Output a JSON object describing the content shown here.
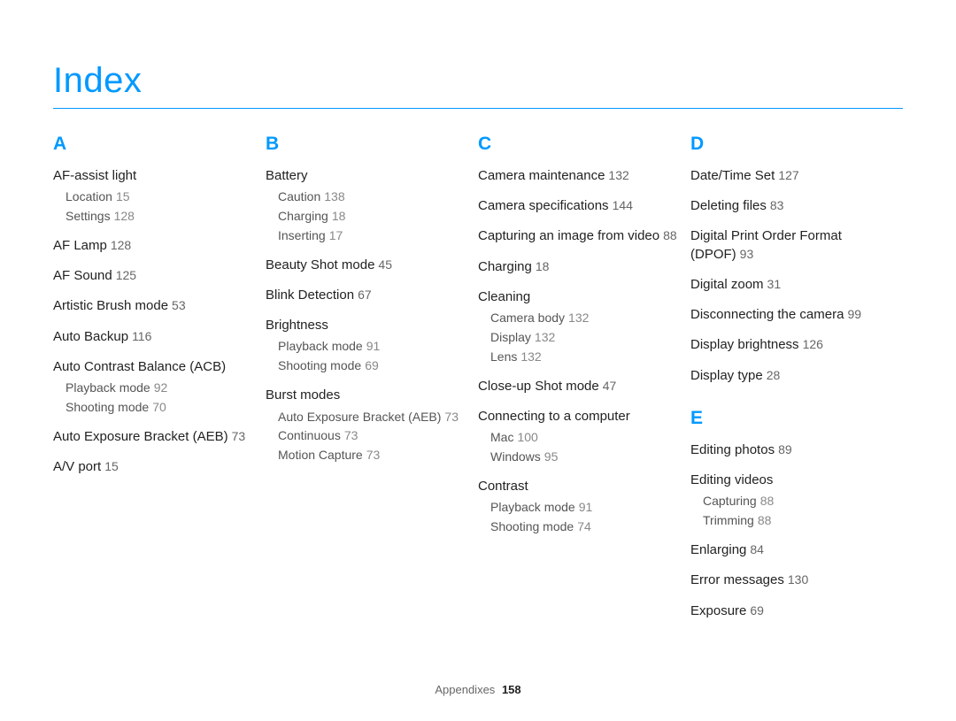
{
  "title": "Index",
  "footer": {
    "label": "Appendixes",
    "page": "158"
  },
  "sections": [
    {
      "letter": "A",
      "groups": [
        {
          "main": "AF-assist light",
          "page": "",
          "subs": [
            {
              "label": "Location",
              "page": "15"
            },
            {
              "label": "Settings",
              "page": "128"
            }
          ]
        },
        {
          "main": "AF Lamp",
          "page": "128",
          "subs": []
        },
        {
          "main": "AF Sound",
          "page": "125",
          "subs": []
        },
        {
          "main": "Artistic Brush mode",
          "page": "53",
          "subs": []
        },
        {
          "main": "Auto Backup",
          "page": "116",
          "subs": []
        },
        {
          "main": "Auto Contrast Balance (ACB)",
          "page": "",
          "subs": [
            {
              "label": "Playback mode",
              "page": "92"
            },
            {
              "label": "Shooting mode",
              "page": "70"
            }
          ]
        },
        {
          "main": "Auto Exposure Bracket (AEB)",
          "page": "73",
          "subs": []
        },
        {
          "main": "A/V port",
          "page": "15",
          "subs": []
        }
      ]
    },
    {
      "letter": "B",
      "groups": [
        {
          "main": "Battery",
          "page": "",
          "subs": [
            {
              "label": "Caution",
              "page": "138"
            },
            {
              "label": "Charging",
              "page": "18"
            },
            {
              "label": "Inserting",
              "page": "17"
            }
          ]
        },
        {
          "main": "Beauty Shot mode",
          "page": "45",
          "subs": []
        },
        {
          "main": "Blink Detection",
          "page": "67",
          "subs": []
        },
        {
          "main": "Brightness",
          "page": "",
          "subs": [
            {
              "label": "Playback mode",
              "page": "91"
            },
            {
              "label": "Shooting mode",
              "page": "69"
            }
          ]
        },
        {
          "main": "Burst modes",
          "page": "",
          "subs": [
            {
              "label": "Auto Exposure Bracket (AEB)",
              "page": "73"
            },
            {
              "label": "Continuous",
              "page": "73"
            },
            {
              "label": "Motion Capture",
              "page": "73"
            }
          ]
        }
      ]
    },
    {
      "letter": "C",
      "groups": [
        {
          "main": "Camera maintenance",
          "page": "132",
          "subs": []
        },
        {
          "main": "Camera specifications",
          "page": "144",
          "subs": []
        },
        {
          "main": "Capturing an image from video",
          "page": "88",
          "subs": []
        },
        {
          "main": "Charging",
          "page": "18",
          "subs": []
        },
        {
          "main": "Cleaning",
          "page": "",
          "subs": [
            {
              "label": "Camera body",
              "page": "132"
            },
            {
              "label": "Display",
              "page": "132"
            },
            {
              "label": "Lens",
              "page": "132"
            }
          ]
        },
        {
          "main": "Close-up Shot mode",
          "page": "47",
          "subs": []
        },
        {
          "main": "Connecting to a computer",
          "page": "",
          "subs": [
            {
              "label": "Mac",
              "page": "100"
            },
            {
              "label": "Windows",
              "page": "95"
            }
          ]
        },
        {
          "main": "Contrast",
          "page": "",
          "subs": [
            {
              "label": "Playback mode",
              "page": "91"
            },
            {
              "label": "Shooting mode",
              "page": "74"
            }
          ]
        }
      ]
    },
    {
      "letter": "D",
      "groups": [
        {
          "main": "Date/Time Set",
          "page": "127",
          "subs": []
        },
        {
          "main": "Deleting files",
          "page": "83",
          "subs": []
        },
        {
          "main": "Digital Print Order Format (DPOF)",
          "page": "93",
          "subs": []
        },
        {
          "main": "Digital zoom",
          "page": "31",
          "subs": []
        },
        {
          "main": "Disconnecting the camera",
          "page": "99",
          "subs": []
        },
        {
          "main": "Display brightness",
          "page": "126",
          "subs": []
        },
        {
          "main": "Display type",
          "page": "28",
          "subs": []
        }
      ]
    },
    {
      "letter": "E",
      "groups": [
        {
          "main": "Editing photos",
          "page": "89",
          "subs": []
        },
        {
          "main": "Editing videos",
          "page": "",
          "subs": [
            {
              "label": "Capturing",
              "page": "88"
            },
            {
              "label": "Trimming",
              "page": "88"
            }
          ]
        },
        {
          "main": "Enlarging",
          "page": "84",
          "subs": []
        },
        {
          "main": "Error messages",
          "page": "130",
          "subs": []
        },
        {
          "main": "Exposure",
          "page": "69",
          "subs": []
        }
      ]
    }
  ]
}
